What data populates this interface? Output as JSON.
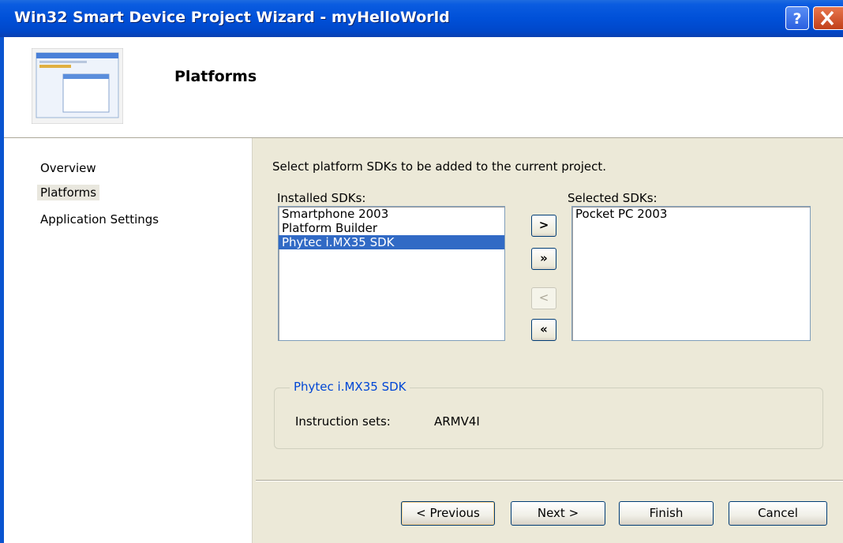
{
  "window": {
    "title": "Win32 Smart Device Project Wizard - myHelloWorld",
    "help_glyph": "?",
    "close_glyph": "X"
  },
  "header": {
    "title": "Platforms"
  },
  "nav": {
    "items": [
      {
        "label": "Overview"
      },
      {
        "label": "Platforms",
        "selected": true
      },
      {
        "label": "Application Settings"
      }
    ]
  },
  "main": {
    "instruction": "Select platform SDKs to be added to the current project.",
    "installed_label": "Installed SDKs:",
    "installed_items": [
      "Smartphone 2003",
      "Platform Builder",
      "Phytec i.MX35 SDK"
    ],
    "installed_selected": "Phytec i.MX35 SDK",
    "selected_label": "Selected SDKs:",
    "selected_items": [
      "Pocket PC 2003"
    ],
    "buttons": {
      "add": ">",
      "add_all": "»",
      "remove": "<",
      "remove_all": "«"
    },
    "details": {
      "group_title": "Phytec i.MX35 SDK",
      "instruction_sets_label": "Instruction sets:",
      "instruction_sets_value": "ARMV4I"
    }
  },
  "footer": {
    "previous": "< Previous",
    "next": "Next >",
    "finish": "Finish",
    "cancel": "Cancel"
  },
  "colors": {
    "titlebar": "#0050d8",
    "selection": "#316ac5",
    "group_title": "#0046d5"
  }
}
